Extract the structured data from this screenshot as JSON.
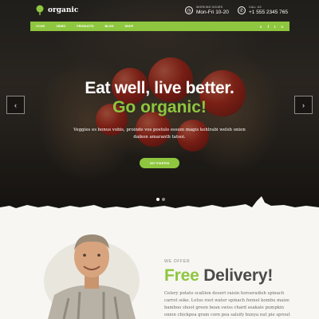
{
  "brand": {
    "name": "organic"
  },
  "header": {
    "hours_label": "WORKING HOURS",
    "hours_value": "Mon-Fri 10-20",
    "call_label": "CALL US",
    "call_value": "+1 555 2345 765"
  },
  "nav": {
    "items": [
      "HOME",
      "VIDEO",
      "PRODUCTS",
      "BLOG",
      "SHOP"
    ],
    "active_index": 0,
    "icons": [
      "search-icon",
      "facebook-icon",
      "twitter-icon",
      "vimeo-icon"
    ]
  },
  "hero": {
    "title_line1": "Eat well, live better.",
    "title_line2": "Go organic!",
    "subtitle": "Veggies es bonus vobis, proinde vos postulo essum magis kohlrabi welsh onion daikon amaranth tatsoi.",
    "cta_label": "GET STARTED",
    "slides_total": 2,
    "slide_active": 1
  },
  "offer": {
    "kicker": "WE OFFER",
    "title_green": "Free",
    "title_dark": "Delivery!",
    "text": "Celery potato scallion desert raisin horseradish spinach carrot soko. Lotus root water spinach fennel kombu maize bamboo shoot green bean swiss chard seakale pumpkin onion chickpea gram corn pea salsify bunya nut pie sprout"
  },
  "colors": {
    "accent": "#8ec63f",
    "dark_text": "#4a4a4a",
    "body_text": "#6b6b6b",
    "background": "#f7f6f2"
  }
}
